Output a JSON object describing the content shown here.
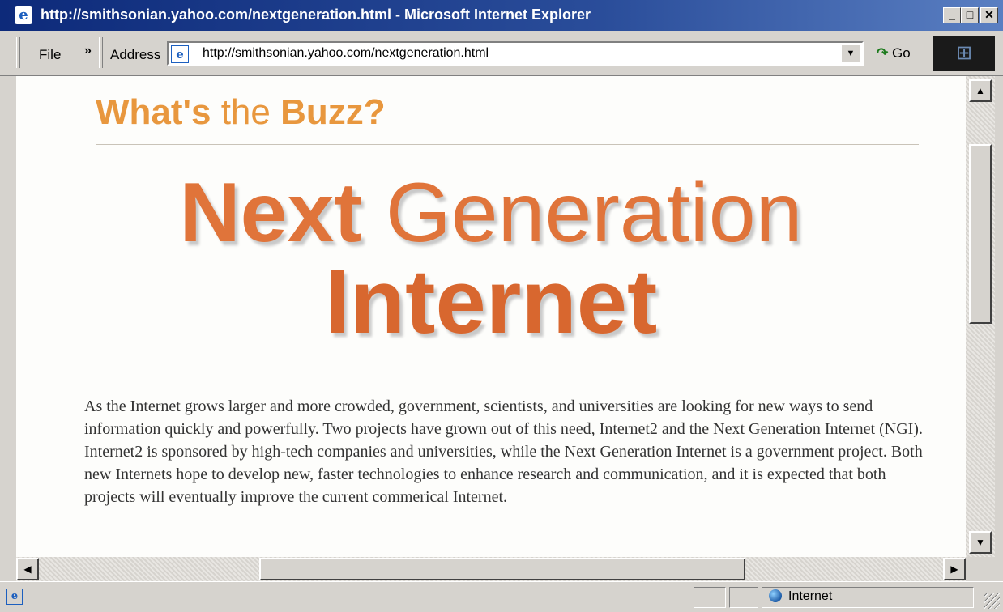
{
  "window": {
    "title": "http://smithsonian.yahoo.com/nextgeneration.html - Microsoft Internet Explorer",
    "minimize_label": "_",
    "maximize_label": "□",
    "close_label": "✕"
  },
  "toolbar": {
    "file_label": "File",
    "chevron_label": "»",
    "address_label": "Address",
    "address_value": "http://smithsonian.yahoo.com/nextgeneration.html",
    "go_label": "Go"
  },
  "page": {
    "buzz": {
      "part1": "What's",
      "part2": "the",
      "part3": "Buzz?"
    },
    "headline": {
      "word1": "Next",
      "word2": "Generation",
      "line2": "Internet"
    },
    "body": "As the Internet grows larger and more crowded, government, scientists, and universities are looking for new ways to send information quickly and powerfully. Two projects have grown out of this need, Internet2 and the Next Generation Internet (NGI). Internet2 is sponsored by high-tech companies and universities, while the Next Generation Internet is a government project. Both new Internets hope to develop new, faster technologies to enhance research and communication, and it is expected that both projects will eventually improve the current commerical Internet."
  },
  "statusbar": {
    "zone_label": "Internet"
  },
  "colors": {
    "title_bar": "#0d2a7a",
    "buzz_orange": "#e8973e",
    "headline_orange": "#e0743a"
  }
}
